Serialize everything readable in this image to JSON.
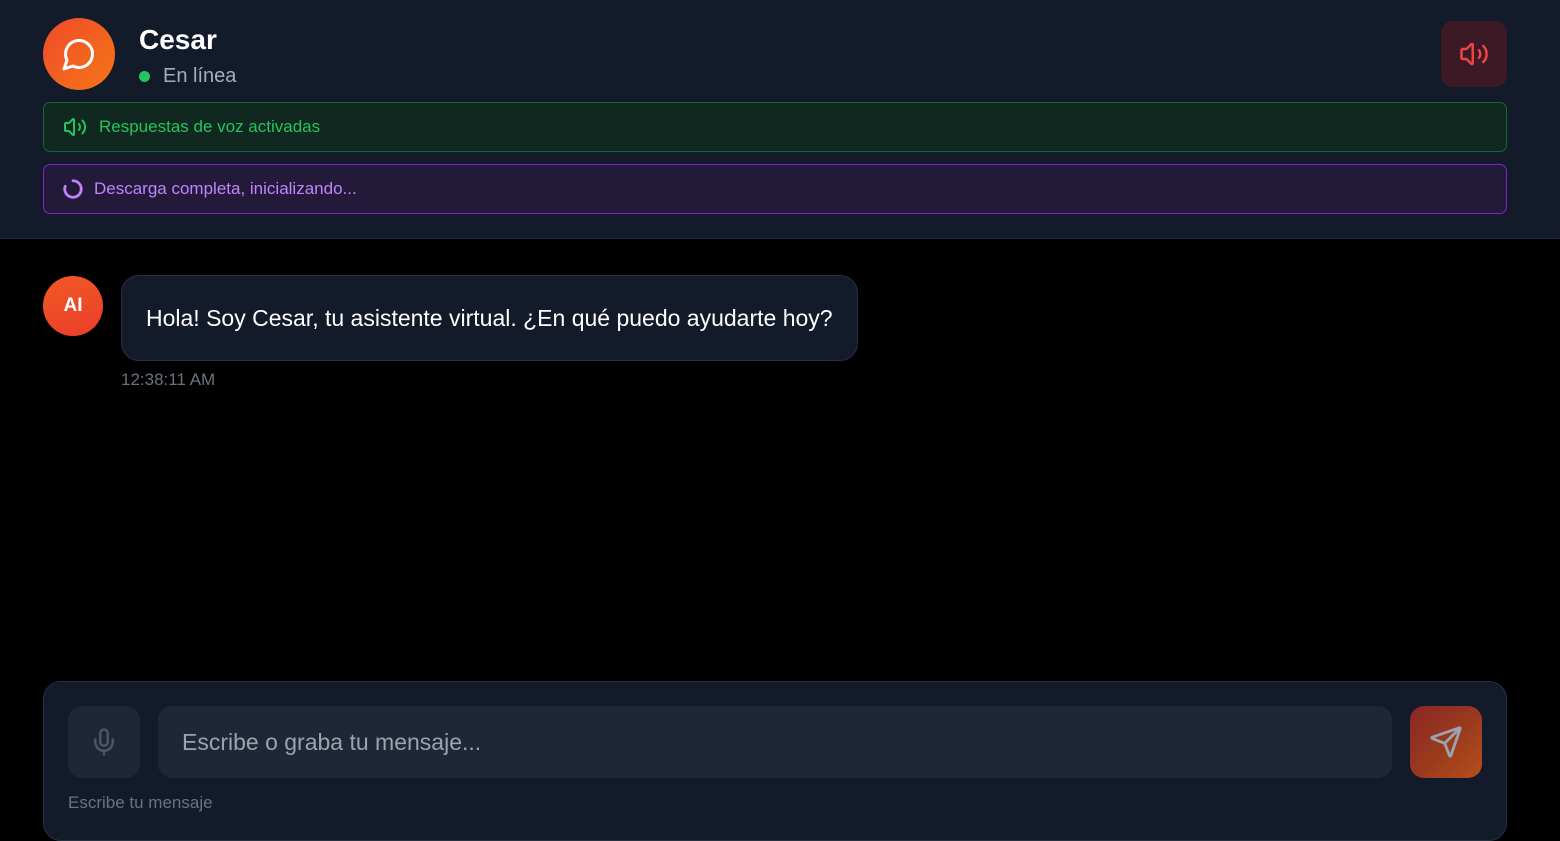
{
  "header": {
    "bot_name": "Cesar",
    "status": "En línea",
    "status_color": "#22c55e",
    "avatar_icon": "chat-bubble-icon",
    "sound_button_icon": "speaker-icon"
  },
  "banners": {
    "voice": {
      "text": "Respuestas de voz activadas",
      "icon": "speaker-icon",
      "color": "#22c55e"
    },
    "loading": {
      "text": "Descarga completa, inicializando...",
      "icon": "spinner-icon",
      "color": "#c084fc"
    }
  },
  "messages": [
    {
      "sender_avatar": "AI",
      "text": "Hola! Soy Cesar, tu asistente virtual. ¿En qué puedo ayudarte hoy?",
      "time": "12:38:11 AM"
    }
  ],
  "composer": {
    "placeholder": "Escribe o graba tu mensaje...",
    "value": "",
    "hint": "Escribe tu mensaje",
    "mic_icon": "microphone-icon",
    "send_icon": "send-icon"
  },
  "colors": {
    "accent": "#f2651f",
    "header_bg": "#131a2a",
    "page_bg": "#000000"
  }
}
